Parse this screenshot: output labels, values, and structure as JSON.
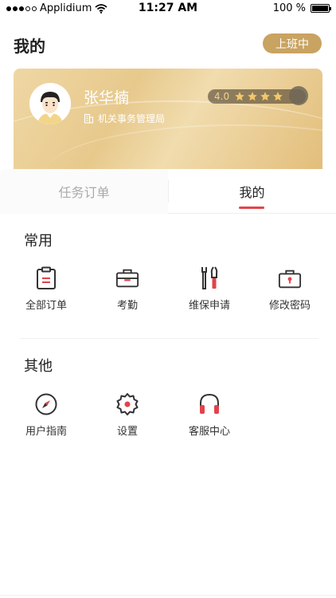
{
  "status_bar": {
    "carrier": "Applidium",
    "time": "11:27 AM",
    "battery": "100 %"
  },
  "header": {
    "title": "我的",
    "duty_badge": "上班中"
  },
  "profile": {
    "name": "张华楠",
    "org": "机关事务管理局",
    "rating": "4.0",
    "stars": 4
  },
  "tabs": [
    {
      "label": "任务订单",
      "active": false
    },
    {
      "label": "我的",
      "active": true
    }
  ],
  "sections": {
    "common": {
      "title": "常用",
      "items": [
        {
          "label": "全部订单",
          "icon": "clipboard-icon"
        },
        {
          "label": "考勤",
          "icon": "briefcase-icon"
        },
        {
          "label": "维保申请",
          "icon": "tools-icon"
        },
        {
          "label": "修改密码",
          "icon": "lock-icon"
        }
      ]
    },
    "other": {
      "title": "其他",
      "items": [
        {
          "label": "用户指南",
          "icon": "compass-icon"
        },
        {
          "label": "设置",
          "icon": "gear-icon"
        },
        {
          "label": "客服中心",
          "icon": "headphones-icon"
        }
      ]
    }
  },
  "colors": {
    "accent_red": "#e2434b",
    "gold": "#c9a361"
  }
}
